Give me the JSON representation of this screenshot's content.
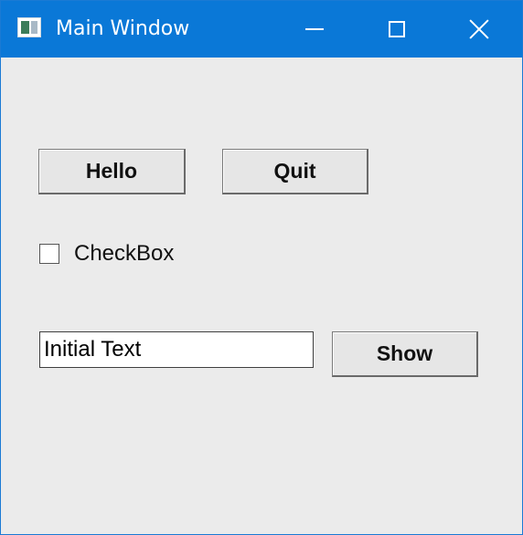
{
  "window": {
    "title": "Main Window",
    "app_icon": "window-app-icon",
    "controls": {
      "minimize_icon": "minimize-icon",
      "maximize_icon": "maximize-icon",
      "close_icon": "close-icon"
    }
  },
  "buttons": {
    "hello_label": "Hello",
    "quit_label": "Quit",
    "show_label": "Show"
  },
  "checkbox": {
    "label": "CheckBox",
    "checked": false
  },
  "text_input": {
    "value": "Initial Text"
  },
  "colors": {
    "titlebar": "#0a78d7",
    "client_background": "#ebebeb",
    "title_text": "#ffffff"
  }
}
